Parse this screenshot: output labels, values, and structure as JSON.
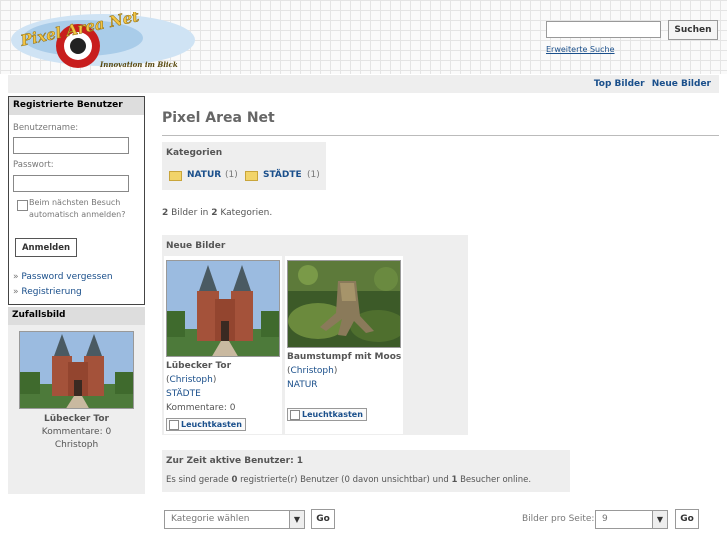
{
  "header": {
    "logo_text": "Pixel Area Net",
    "logo_tagline": "Innovation im Blick",
    "search_placeholder": "",
    "search_button": "Suchen",
    "advanced_search": "Erweiterte Suche"
  },
  "nav": {
    "top_images": "Top Bilder",
    "new_images": "Neue Bilder"
  },
  "login": {
    "title": "Registrierte Benutzer",
    "username_label": "Benutzername:",
    "password_label": "Passwort:",
    "remember_line1": "Beim nächsten Besuch",
    "remember_line2": "automatisch anmelden?",
    "login_button": "Anmelden",
    "bullet": "»",
    "forgot_password": "Password vergessen",
    "register": "Registrierung"
  },
  "random": {
    "title": "Zufallsbild",
    "image_name": "Lübecker Tor",
    "comments": "Kommentare: 0",
    "author": "Christoph"
  },
  "main": {
    "title": "Pixel Area Net",
    "categories_title": "Kategorien",
    "categories": [
      {
        "name": "NATUR",
        "count": "(1)"
      },
      {
        "name": "STÄDTE",
        "count": "(1)"
      }
    ],
    "stats": {
      "images": "2",
      "text1": "Bilder in",
      "categories": "2",
      "text2": "Kategorien."
    },
    "new_images_title": "Neue Bilder",
    "images": [
      {
        "title": "Lübecker Tor",
        "author_open": "(",
        "author": "Christoph",
        "author_close": ")",
        "category": "STÄDTE",
        "comments": "Kommentare: 0",
        "lightbox": "Leuchtkasten"
      },
      {
        "title": "Baumstumpf mit Moos",
        "author_open": "(",
        "author": "Christoph",
        "author_close": ")",
        "category": "NATUR",
        "lightbox": "Leuchtkasten"
      }
    ],
    "active_users_title": "Zur Zeit aktive Benutzer: 1",
    "active_users": {
      "p1": "Es sind gerade",
      "registered": "0",
      "p2": "registrierte(r) Benutzer (0 davon unsichtbar) und",
      "guests": "1",
      "p3": "Besucher online."
    }
  },
  "footer": {
    "category_select": "Kategorie wählen",
    "go": "Go",
    "per_page_label": "Bilder pro Seite:",
    "per_page_value": "9"
  }
}
